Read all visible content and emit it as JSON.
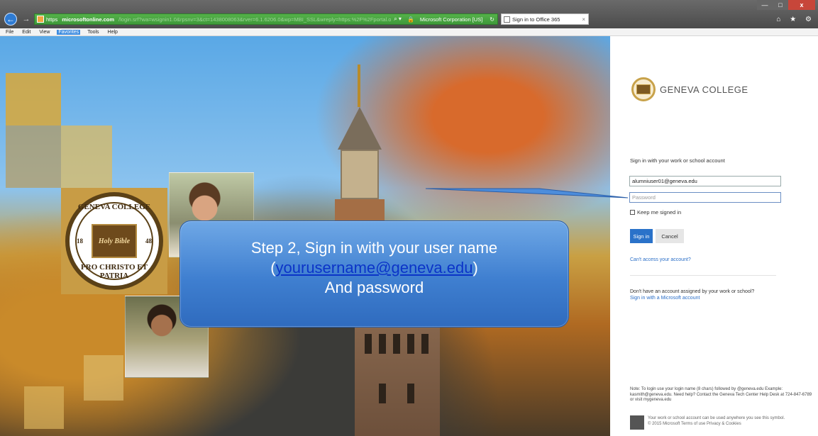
{
  "browser": {
    "address": {
      "protocol": "https",
      "host": "microsoftonline.com",
      "rest": "/login.srf?wa=wsignin1.0&rpsnv=3&ct=1438008063&rver=6.1.6206.0&wp=MBI_SSL&wreply=https:%2F%2Fportal.office.com",
      "cert": "Microsoft Corporation [US]"
    },
    "tab_title": "Sign in to Office 365",
    "window_controls": {
      "minimize": "—",
      "maximize": "□",
      "close": "x"
    },
    "toolbar_icons": "⌂ ★ ⚙"
  },
  "menu": [
    "File",
    "Edit",
    "View",
    "Favorites",
    "Tools",
    "Help"
  ],
  "seal": {
    "top": "GENEVA COLLEGE",
    "center": "Holy Bible",
    "left": "18",
    "right": "48",
    "bottom": "PRO CHRISTO ET PATRIA"
  },
  "callout": {
    "line1": "Step 2, Sign in with your user name",
    "open_paren": "(",
    "link": "yourusername@geneva.edu",
    "close_paren": ")",
    "line3": "And password"
  },
  "signin": {
    "org_name": "GENEVA COLLEGE",
    "heading": "Sign in with your work or school account",
    "username_value": "alumniuser01@geneva.edu",
    "password_placeholder": "Password",
    "keep_signed_in": "Keep me signed in",
    "signin_button": "Sign in",
    "cancel_button": "Cancel",
    "cant_access": "Can't access your account?",
    "no_account_text": "Don't have an account assigned by your work or school?",
    "ms_account_link": "Sign in with a Microsoft account",
    "note": "Note: To login use your login name (8 chars) followed by @geneva.edu Example: kasmith@geneva.edu. Need help? Contact the Geneva Tech Center Help Desk at 724-847-6789 or visit mygeneva.edu",
    "footer_line1": "Your work or school account can be used anywhere you see this symbol.",
    "footer_line2": "© 2015 Microsoft  Terms of use  Privacy & Cookies"
  }
}
